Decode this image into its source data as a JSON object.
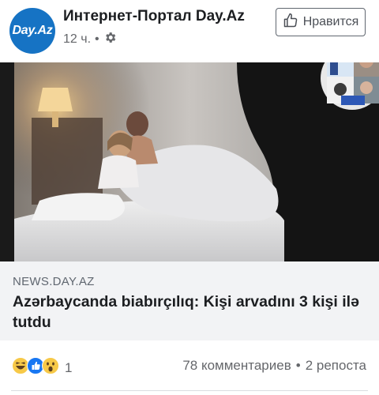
{
  "post": {
    "page_name": "Интернет-Портал Day.Az",
    "avatar_text": "Day.Az",
    "time": "12 ч.",
    "separator": "•",
    "privacy_icon": "gear-icon",
    "like_button_label": "Нравится",
    "like_icon": "thumbs-up-icon",
    "ad_notification_badge": "!"
  },
  "link": {
    "domain": "NEWS.DAY.AZ",
    "headline": "Azərbaycanda biabırçılıq: Kişi arvadını 3 kişi ilə tutdu"
  },
  "footer": {
    "reactions": [
      "haha",
      "like",
      "wow"
    ],
    "reaction_count": "1",
    "comments": "78 комментариев",
    "separator": "•",
    "shares": "2 репоста"
  },
  "colors": {
    "brand_blue": "#1673c4",
    "text_primary": "#1c1e21",
    "text_secondary": "#65676b",
    "link_box_bg": "#f2f3f5",
    "like_blue": "#1877f2",
    "reaction_yellow": "#f7c948"
  }
}
